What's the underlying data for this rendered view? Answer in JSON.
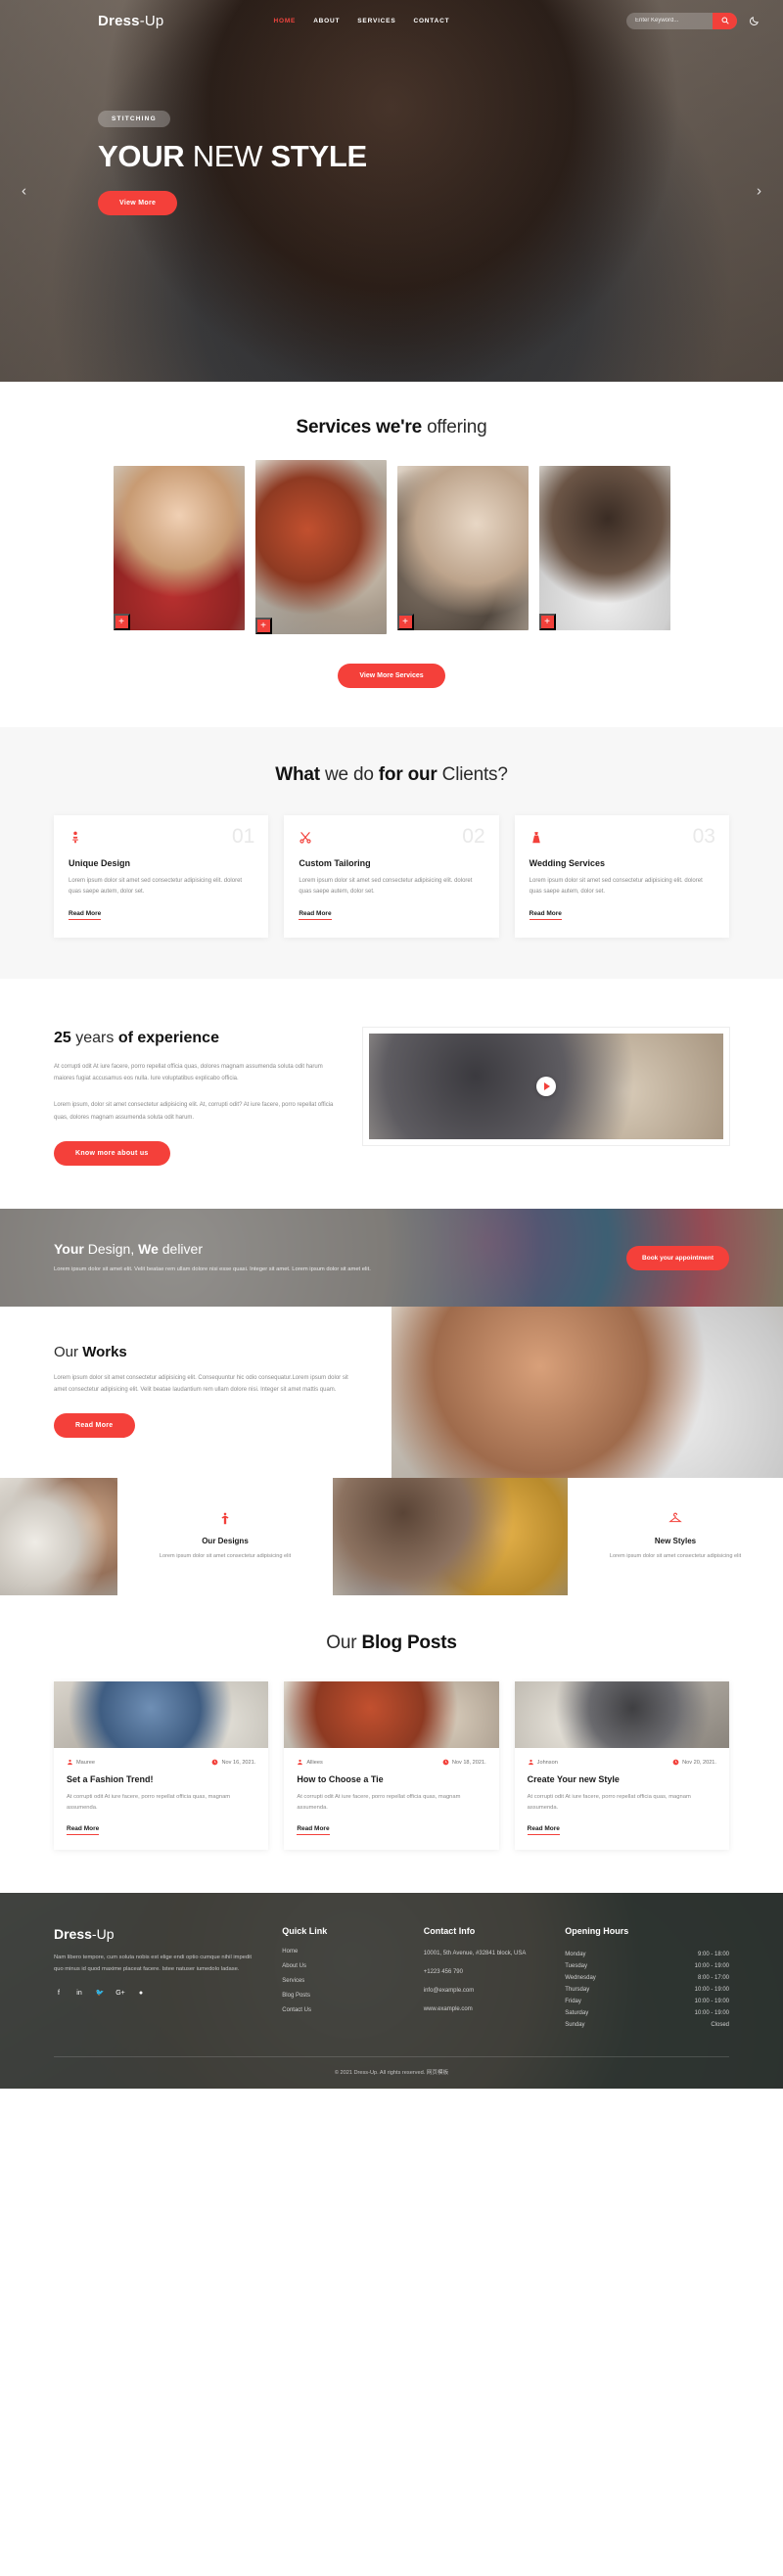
{
  "header": {
    "brand_bold": "Dress",
    "brand_rest": "-Up",
    "nav": [
      {
        "label": "HOME",
        "active": true
      },
      {
        "label": "ABOUT",
        "active": false
      },
      {
        "label": "SERVICES",
        "active": false
      },
      {
        "label": "CONTACT",
        "active": false
      }
    ],
    "search_placeholder": "Enter Keyword...",
    "search_value": "",
    "search_icon": "search-icon",
    "theme_icon": "moon-icon"
  },
  "hero": {
    "badge": "STITCHING",
    "title_1": "YOUR",
    "title_2": " NEW ",
    "title_3": "STYLE",
    "button": "View More",
    "prev": "‹",
    "next": "›"
  },
  "services": {
    "title_bold": "Services we're",
    "title_rest": " offering",
    "cards": [
      {
        "alt": "service-photo-1",
        "plus": "+"
      },
      {
        "alt": "service-photo-2",
        "plus": "+"
      },
      {
        "alt": "service-photo-3",
        "plus": "+"
      },
      {
        "alt": "service-photo-4",
        "plus": "+"
      }
    ],
    "more_button": "View More Services"
  },
  "clients": {
    "title_1": "What",
    "title_2": " we do ",
    "title_3": "for our",
    "title_4": " Clients?",
    "cards": [
      {
        "icon": "mannequin-icon",
        "number": "01",
        "title": "Unique Design",
        "text": "Lorem ipsum dolor sit amet sed consectetur adipisicing elit. doloret quas saepe autem, dolor set.",
        "link": "Read More"
      },
      {
        "icon": "scissors-icon",
        "number": "02",
        "title": "Custom Tailoring",
        "text": "Lorem ipsum dolor sit amet sed consectetur adipisicing elit. doloret quas saepe autem, dolor set.",
        "link": "Read More"
      },
      {
        "icon": "wedding-dress-icon",
        "number": "03",
        "title": "Wedding Services",
        "text": "Lorem ipsum dolor sit amet sed consectetur adipisicing elit. doloret quas saepe autem, dolor set.",
        "link": "Read More"
      }
    ]
  },
  "experience": {
    "title_bold1": "25",
    "title_rest1": " years ",
    "title_bold2": "of experience",
    "paragraph1": "At corrupti odit At iure facere, porro repellat officia quas, dolores magnam assumenda soluta odit harum maiores fugiat accusamus eos nulla. Iure voluptatibus explicabo officia.",
    "paragraph2": "Lorem ipsum, dolor sit amet consectetur adipisicing elit. At, corrupti odit? At iure facere, porro repellat officia quas, dolores magnam assumenda soluta odit harum.",
    "button": "Know more about us",
    "play_icon": "play-icon"
  },
  "banner": {
    "title_1": "Your",
    "title_2": " Design, ",
    "title_3": "We",
    "title_4": " deliver",
    "text": "Lorem ipsum dolor sit amet elit. Velit beatae rem ullam dolore nisi esse quasi. Integer sit amet. Lorem ipsum dolor sit amet elit.",
    "button": "Book your appointment"
  },
  "works": {
    "title_rest": "Our ",
    "title_bold": "Works",
    "text": "Lorem ipsum dolor sit amet consectetur adipisicing elit. Consequuntur hic odio consequatur.Lorem ipsum dolor sit amet consectetur adipisicing elit. Velit beatae laudantium rem ullam dolore nisi. Integer sit amet mattis quam.",
    "button": "Read More",
    "features": [
      {
        "icon": "dress-form-icon",
        "title": "Our Designs",
        "text": "Lorem ipsum dolor sit amet consectetur adipisicing elit"
      },
      {
        "icon": "hanger-icon",
        "title": "New Styles",
        "text": "Lorem ipsum dolor sit amet consectetur adipisicing elit"
      }
    ]
  },
  "blog": {
    "title_rest": "Our ",
    "title_bold": "Blog Posts",
    "posts": [
      {
        "author": "Mauree",
        "author_icon": "user-icon",
        "date": "Nov 16, 2021.",
        "date_icon": "clock-icon",
        "title": "Set a Fashion Trend!",
        "text": "At corrupti odit At iure facere, porro repellat officia quas, magnam assumenda.",
        "link": "Read More"
      },
      {
        "author": "Alliees",
        "author_icon": "user-icon",
        "date": "Nov 18, 2021.",
        "date_icon": "clock-icon",
        "title": "How to Choose a Tie",
        "text": "At corrupti odit At iure facere, porro repellat officia quas, magnam assumenda.",
        "link": "Read More"
      },
      {
        "author": "Johnson",
        "author_icon": "user-icon",
        "date": "Nov 20, 2021.",
        "date_icon": "clock-icon",
        "title": "Create Your new Style",
        "text": "At corrupti odit At iure facere, porro repellat officia quas, magnam assumenda.",
        "link": "Read More"
      }
    ]
  },
  "footer": {
    "brand_bold": "Dress",
    "brand_rest": "-Up",
    "about": "Nam libero tempore, cum soluta nobis est elige endi optio cumque nihil impedit quo minus id quod maxime placeat facere. Istee natuser iumedolo ladase.",
    "social": [
      {
        "icon": "facebook-icon",
        "glyph": "f"
      },
      {
        "icon": "linkedin-icon",
        "glyph": "in"
      },
      {
        "icon": "twitter-icon",
        "glyph": "🐦"
      },
      {
        "icon": "google-plus-icon",
        "glyph": "G+"
      },
      {
        "icon": "github-icon",
        "glyph": "●"
      }
    ],
    "quick_link_heading": "Quick Link",
    "quick_links": [
      "Home",
      "About Us",
      "Services",
      "Blog Posts",
      "Contact Us"
    ],
    "contact_heading": "Contact Info",
    "contact": [
      "10001, 5th Avenue, #32841 block, USA",
      "+1223 456 790",
      "info@example.com",
      "www.example.com"
    ],
    "hours_heading": "Opening Hours",
    "hours": [
      {
        "day": "Monday",
        "time": "9:00 - 18:00"
      },
      {
        "day": "Tuesday",
        "time": "10:00 - 19:00"
      },
      {
        "day": "Wednesday",
        "time": "8:00 - 17:00"
      },
      {
        "day": "Thursday",
        "time": "10:00 - 19:00"
      },
      {
        "day": "Friday",
        "time": "10:00 - 19:00"
      },
      {
        "day": "Saturday",
        "time": "10:00 - 19:00"
      },
      {
        "day": "Sunday",
        "time": "Closed"
      }
    ],
    "copyright": "© 2021 Dress-Up. All rights reserved. 网页模板"
  },
  "colors": {
    "accent": "#f2403a",
    "dark": "#131313",
    "muted": "#8a8a8a",
    "footer_bg": "#2c302e"
  }
}
